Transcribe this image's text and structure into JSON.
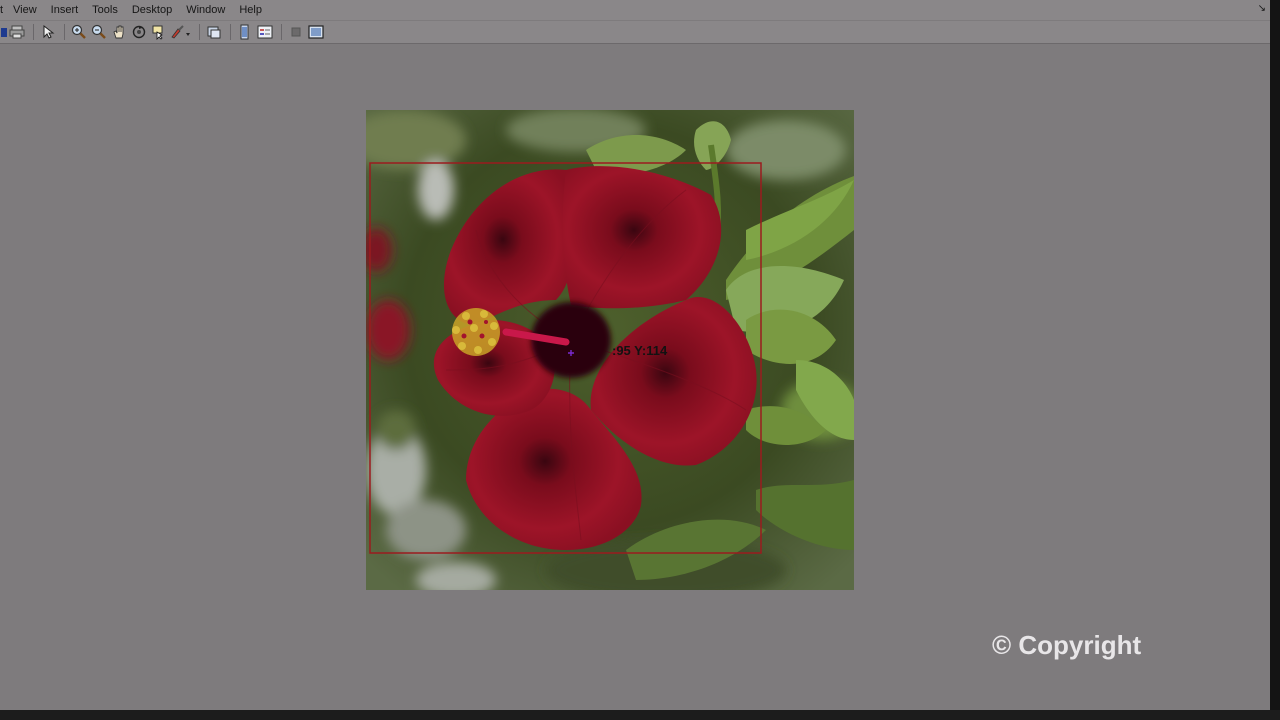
{
  "menubar": {
    "edge_glyph": "t",
    "items": [
      "View",
      "Insert",
      "Tools",
      "Desktop",
      "Window",
      "Help"
    ],
    "right_glyph": "↘"
  },
  "toolbar": {
    "buttons": [
      "save-icon",
      "print-icon",
      "pointer-icon",
      "zoom-in-icon",
      "zoom-out-icon",
      "pan-icon",
      "rotate-icon",
      "data-cursor-icon",
      "brush-icon",
      "link-icon",
      "colorbar-icon",
      "legend-icon",
      "hide-tools-icon",
      "dock-icon"
    ]
  },
  "figure": {
    "cursor_readout": ":95 Y:114",
    "box_color": "#9b1b1e",
    "flower_color": "#a01425"
  },
  "watermark": {
    "text": "© Copyright"
  }
}
